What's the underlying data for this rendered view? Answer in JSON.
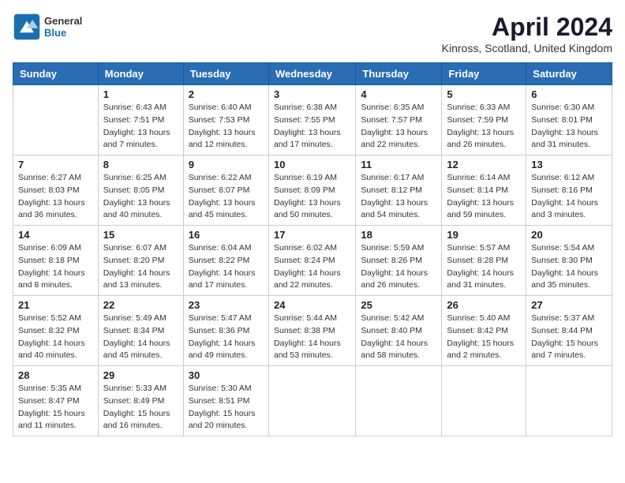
{
  "header": {
    "logo_general": "General",
    "logo_blue": "Blue",
    "month_title": "April 2024",
    "location": "Kinross, Scotland, United Kingdom"
  },
  "weekdays": [
    "Sunday",
    "Monday",
    "Tuesday",
    "Wednesday",
    "Thursday",
    "Friday",
    "Saturday"
  ],
  "weeks": [
    [
      {
        "day": "",
        "info": ""
      },
      {
        "day": "1",
        "info": "Sunrise: 6:43 AM\nSunset: 7:51 PM\nDaylight: 13 hours\nand 7 minutes."
      },
      {
        "day": "2",
        "info": "Sunrise: 6:40 AM\nSunset: 7:53 PM\nDaylight: 13 hours\nand 12 minutes."
      },
      {
        "day": "3",
        "info": "Sunrise: 6:38 AM\nSunset: 7:55 PM\nDaylight: 13 hours\nand 17 minutes."
      },
      {
        "day": "4",
        "info": "Sunrise: 6:35 AM\nSunset: 7:57 PM\nDaylight: 13 hours\nand 22 minutes."
      },
      {
        "day": "5",
        "info": "Sunrise: 6:33 AM\nSunset: 7:59 PM\nDaylight: 13 hours\nand 26 minutes."
      },
      {
        "day": "6",
        "info": "Sunrise: 6:30 AM\nSunset: 8:01 PM\nDaylight: 13 hours\nand 31 minutes."
      }
    ],
    [
      {
        "day": "7",
        "info": "Sunrise: 6:27 AM\nSunset: 8:03 PM\nDaylight: 13 hours\nand 36 minutes."
      },
      {
        "day": "8",
        "info": "Sunrise: 6:25 AM\nSunset: 8:05 PM\nDaylight: 13 hours\nand 40 minutes."
      },
      {
        "day": "9",
        "info": "Sunrise: 6:22 AM\nSunset: 8:07 PM\nDaylight: 13 hours\nand 45 minutes."
      },
      {
        "day": "10",
        "info": "Sunrise: 6:19 AM\nSunset: 8:09 PM\nDaylight: 13 hours\nand 50 minutes."
      },
      {
        "day": "11",
        "info": "Sunrise: 6:17 AM\nSunset: 8:12 PM\nDaylight: 13 hours\nand 54 minutes."
      },
      {
        "day": "12",
        "info": "Sunrise: 6:14 AM\nSunset: 8:14 PM\nDaylight: 13 hours\nand 59 minutes."
      },
      {
        "day": "13",
        "info": "Sunrise: 6:12 AM\nSunset: 8:16 PM\nDaylight: 14 hours\nand 3 minutes."
      }
    ],
    [
      {
        "day": "14",
        "info": "Sunrise: 6:09 AM\nSunset: 8:18 PM\nDaylight: 14 hours\nand 8 minutes."
      },
      {
        "day": "15",
        "info": "Sunrise: 6:07 AM\nSunset: 8:20 PM\nDaylight: 14 hours\nand 13 minutes."
      },
      {
        "day": "16",
        "info": "Sunrise: 6:04 AM\nSunset: 8:22 PM\nDaylight: 14 hours\nand 17 minutes."
      },
      {
        "day": "17",
        "info": "Sunrise: 6:02 AM\nSunset: 8:24 PM\nDaylight: 14 hours\nand 22 minutes."
      },
      {
        "day": "18",
        "info": "Sunrise: 5:59 AM\nSunset: 8:26 PM\nDaylight: 14 hours\nand 26 minutes."
      },
      {
        "day": "19",
        "info": "Sunrise: 5:57 AM\nSunset: 8:28 PM\nDaylight: 14 hours\nand 31 minutes."
      },
      {
        "day": "20",
        "info": "Sunrise: 5:54 AM\nSunset: 8:30 PM\nDaylight: 14 hours\nand 35 minutes."
      }
    ],
    [
      {
        "day": "21",
        "info": "Sunrise: 5:52 AM\nSunset: 8:32 PM\nDaylight: 14 hours\nand 40 minutes."
      },
      {
        "day": "22",
        "info": "Sunrise: 5:49 AM\nSunset: 8:34 PM\nDaylight: 14 hours\nand 45 minutes."
      },
      {
        "day": "23",
        "info": "Sunrise: 5:47 AM\nSunset: 8:36 PM\nDaylight: 14 hours\nand 49 minutes."
      },
      {
        "day": "24",
        "info": "Sunrise: 5:44 AM\nSunset: 8:38 PM\nDaylight: 14 hours\nand 53 minutes."
      },
      {
        "day": "25",
        "info": "Sunrise: 5:42 AM\nSunset: 8:40 PM\nDaylight: 14 hours\nand 58 minutes."
      },
      {
        "day": "26",
        "info": "Sunrise: 5:40 AM\nSunset: 8:42 PM\nDaylight: 15 hours\nand 2 minutes."
      },
      {
        "day": "27",
        "info": "Sunrise: 5:37 AM\nSunset: 8:44 PM\nDaylight: 15 hours\nand 7 minutes."
      }
    ],
    [
      {
        "day": "28",
        "info": "Sunrise: 5:35 AM\nSunset: 8:47 PM\nDaylight: 15 hours\nand 11 minutes."
      },
      {
        "day": "29",
        "info": "Sunrise: 5:33 AM\nSunset: 8:49 PM\nDaylight: 15 hours\nand 16 minutes."
      },
      {
        "day": "30",
        "info": "Sunrise: 5:30 AM\nSunset: 8:51 PM\nDaylight: 15 hours\nand 20 minutes."
      },
      {
        "day": "",
        "info": ""
      },
      {
        "day": "",
        "info": ""
      },
      {
        "day": "",
        "info": ""
      },
      {
        "day": "",
        "info": ""
      }
    ]
  ]
}
